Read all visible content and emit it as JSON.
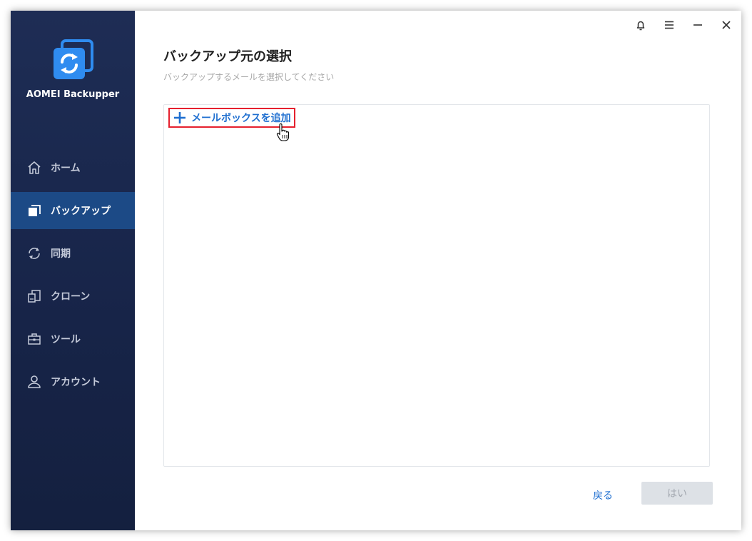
{
  "app": {
    "name": "AOMEI Backupper"
  },
  "titlebar": {
    "icons": [
      "bell-icon",
      "menu-icon",
      "minimize-icon",
      "close-icon"
    ]
  },
  "sidebar": {
    "items": [
      {
        "label": "ホーム",
        "icon": "home-icon",
        "active": false
      },
      {
        "label": "バックアップ",
        "icon": "backup-icon",
        "active": true
      },
      {
        "label": "同期",
        "icon": "sync-icon",
        "active": false
      },
      {
        "label": "クローン",
        "icon": "clone-icon",
        "active": false
      },
      {
        "label": "ツール",
        "icon": "toolbox-icon",
        "active": false
      },
      {
        "label": "アカウント",
        "icon": "user-icon",
        "active": false
      }
    ]
  },
  "main": {
    "title": "バックアップ元の選択",
    "subtitle": "バックアップするメールを選択してください",
    "add_mailbox_label": "メールボックスを追加",
    "back_label": "戻る",
    "ok_label": "はい"
  },
  "colors": {
    "sidebar_bg": "#1e2d55",
    "active_item": "#1c4a86",
    "accent": "#1f6fd0",
    "highlight": "#e5202e"
  }
}
